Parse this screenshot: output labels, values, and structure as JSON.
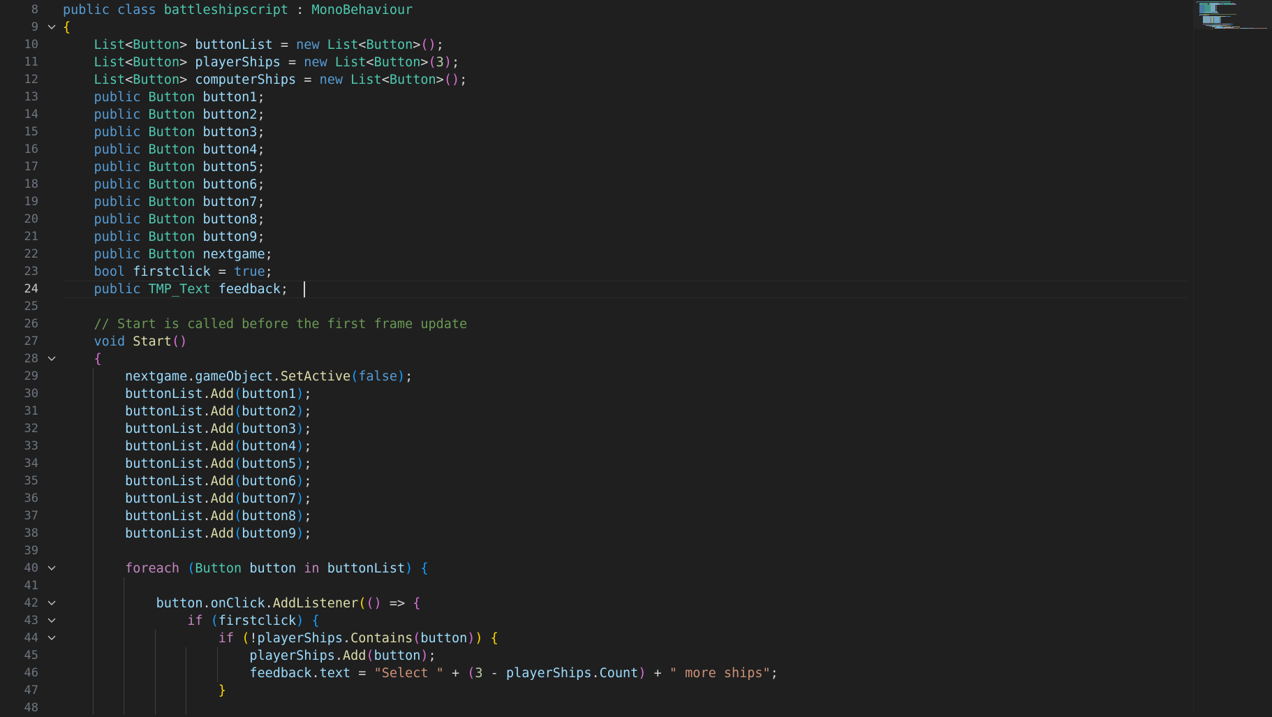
{
  "editor": {
    "language": "C#",
    "active_line": 24,
    "cursor_line": 24,
    "cursor_col": 31,
    "fold_lines": [
      9,
      28,
      40,
      42,
      43,
      44
    ],
    "line_numbers": [
      "8",
      "9",
      "10",
      "11",
      "12",
      "13",
      "14",
      "15",
      "16",
      "17",
      "18",
      "19",
      "20",
      "21",
      "22",
      "23",
      "24",
      "25",
      "26",
      "27",
      "28",
      "29",
      "30",
      "31",
      "32",
      "33",
      "34",
      "35",
      "36",
      "37",
      "38",
      "39",
      "40",
      "41",
      "42",
      "43",
      "44",
      "45",
      "46",
      "47",
      "48"
    ],
    "lines": [
      {
        "n": 8,
        "indent": 0,
        "tokens": [
          [
            "kw",
            "public "
          ],
          [
            "kw",
            "class "
          ],
          [
            "type",
            "battleshipscript "
          ],
          [
            "pun",
            ": "
          ],
          [
            "type",
            "MonoBehaviour"
          ]
        ]
      },
      {
        "n": 9,
        "indent": 0,
        "tokens": [
          [
            "b1",
            "{"
          ]
        ]
      },
      {
        "n": 10,
        "indent": 4,
        "tokens": [
          [
            "type",
            "List"
          ],
          [
            "pun",
            "<"
          ],
          [
            "type",
            "Button"
          ],
          [
            "pun",
            "> "
          ],
          [
            "var",
            "buttonList "
          ],
          [
            "pun",
            "= "
          ],
          [
            "kw",
            "new "
          ],
          [
            "type",
            "List"
          ],
          [
            "pun",
            "<"
          ],
          [
            "type",
            "Button"
          ],
          [
            "pun",
            ">"
          ],
          [
            "b2",
            "()"
          ],
          [
            "pun",
            ";"
          ]
        ]
      },
      {
        "n": 11,
        "indent": 4,
        "tokens": [
          [
            "type",
            "List"
          ],
          [
            "pun",
            "<"
          ],
          [
            "type",
            "Button"
          ],
          [
            "pun",
            "> "
          ],
          [
            "var",
            "playerShips "
          ],
          [
            "pun",
            "= "
          ],
          [
            "kw",
            "new "
          ],
          [
            "type",
            "List"
          ],
          [
            "pun",
            "<"
          ],
          [
            "type",
            "Button"
          ],
          [
            "pun",
            ">"
          ],
          [
            "b2",
            "("
          ],
          [
            "num",
            "3"
          ],
          [
            "b2",
            ")"
          ],
          [
            "pun",
            ";"
          ]
        ]
      },
      {
        "n": 12,
        "indent": 4,
        "tokens": [
          [
            "type",
            "List"
          ],
          [
            "pun",
            "<"
          ],
          [
            "type",
            "Button"
          ],
          [
            "pun",
            "> "
          ],
          [
            "var",
            "computerShips "
          ],
          [
            "pun",
            "= "
          ],
          [
            "kw",
            "new "
          ],
          [
            "type",
            "List"
          ],
          [
            "pun",
            "<"
          ],
          [
            "type",
            "Button"
          ],
          [
            "pun",
            ">"
          ],
          [
            "b2",
            "()"
          ],
          [
            "pun",
            ";"
          ]
        ]
      },
      {
        "n": 13,
        "indent": 4,
        "tokens": [
          [
            "kw",
            "public "
          ],
          [
            "type",
            "Button "
          ],
          [
            "var",
            "button1"
          ],
          [
            "pun",
            ";"
          ]
        ]
      },
      {
        "n": 14,
        "indent": 4,
        "tokens": [
          [
            "kw",
            "public "
          ],
          [
            "type",
            "Button "
          ],
          [
            "var",
            "button2"
          ],
          [
            "pun",
            ";"
          ]
        ]
      },
      {
        "n": 15,
        "indent": 4,
        "tokens": [
          [
            "kw",
            "public "
          ],
          [
            "type",
            "Button "
          ],
          [
            "var",
            "button3"
          ],
          [
            "pun",
            ";"
          ]
        ]
      },
      {
        "n": 16,
        "indent": 4,
        "tokens": [
          [
            "kw",
            "public "
          ],
          [
            "type",
            "Button "
          ],
          [
            "var",
            "button4"
          ],
          [
            "pun",
            ";"
          ]
        ]
      },
      {
        "n": 17,
        "indent": 4,
        "tokens": [
          [
            "kw",
            "public "
          ],
          [
            "type",
            "Button "
          ],
          [
            "var",
            "button5"
          ],
          [
            "pun",
            ";"
          ]
        ]
      },
      {
        "n": 18,
        "indent": 4,
        "tokens": [
          [
            "kw",
            "public "
          ],
          [
            "type",
            "Button "
          ],
          [
            "var",
            "button6"
          ],
          [
            "pun",
            ";"
          ]
        ]
      },
      {
        "n": 19,
        "indent": 4,
        "tokens": [
          [
            "kw",
            "public "
          ],
          [
            "type",
            "Button "
          ],
          [
            "var",
            "button7"
          ],
          [
            "pun",
            ";"
          ]
        ]
      },
      {
        "n": 20,
        "indent": 4,
        "tokens": [
          [
            "kw",
            "public "
          ],
          [
            "type",
            "Button "
          ],
          [
            "var",
            "button8"
          ],
          [
            "pun",
            ";"
          ]
        ]
      },
      {
        "n": 21,
        "indent": 4,
        "tokens": [
          [
            "kw",
            "public "
          ],
          [
            "type",
            "Button "
          ],
          [
            "var",
            "button9"
          ],
          [
            "pun",
            ";"
          ]
        ]
      },
      {
        "n": 22,
        "indent": 4,
        "tokens": [
          [
            "kw",
            "public "
          ],
          [
            "type",
            "Button "
          ],
          [
            "var",
            "nextgame"
          ],
          [
            "pun",
            ";"
          ]
        ]
      },
      {
        "n": 23,
        "indent": 4,
        "tokens": [
          [
            "kw",
            "bool "
          ],
          [
            "var",
            "firstclick "
          ],
          [
            "pun",
            "= "
          ],
          [
            "kw",
            "true"
          ],
          [
            "pun",
            ";"
          ]
        ]
      },
      {
        "n": 24,
        "indent": 4,
        "tokens": [
          [
            "kw",
            "public "
          ],
          [
            "type",
            "TMP_Text "
          ],
          [
            "var",
            "feedback"
          ],
          [
            "pun",
            ";"
          ]
        ]
      },
      {
        "n": 25,
        "indent": 0,
        "tokens": []
      },
      {
        "n": 26,
        "indent": 4,
        "tokens": [
          [
            "com",
            "// Start is called before the first frame update"
          ]
        ]
      },
      {
        "n": 27,
        "indent": 4,
        "tokens": [
          [
            "kw",
            "void "
          ],
          [
            "fn",
            "Start"
          ],
          [
            "b2",
            "()"
          ]
        ]
      },
      {
        "n": 28,
        "indent": 4,
        "tokens": [
          [
            "b2",
            "{"
          ]
        ]
      },
      {
        "n": 29,
        "indent": 8,
        "tokens": [
          [
            "var",
            "nextgame"
          ],
          [
            "pun",
            "."
          ],
          [
            "var",
            "gameObject"
          ],
          [
            "pun",
            "."
          ],
          [
            "fn",
            "SetActive"
          ],
          [
            "b3",
            "("
          ],
          [
            "kw",
            "false"
          ],
          [
            "b3",
            ")"
          ],
          [
            "pun",
            ";"
          ]
        ]
      },
      {
        "n": 30,
        "indent": 8,
        "tokens": [
          [
            "var",
            "buttonList"
          ],
          [
            "pun",
            "."
          ],
          [
            "fn",
            "Add"
          ],
          [
            "b3",
            "("
          ],
          [
            "var",
            "button1"
          ],
          [
            "b3",
            ")"
          ],
          [
            "pun",
            ";"
          ]
        ]
      },
      {
        "n": 31,
        "indent": 8,
        "tokens": [
          [
            "var",
            "buttonList"
          ],
          [
            "pun",
            "."
          ],
          [
            "fn",
            "Add"
          ],
          [
            "b3",
            "("
          ],
          [
            "var",
            "button2"
          ],
          [
            "b3",
            ")"
          ],
          [
            "pun",
            ";"
          ]
        ]
      },
      {
        "n": 32,
        "indent": 8,
        "tokens": [
          [
            "var",
            "buttonList"
          ],
          [
            "pun",
            "."
          ],
          [
            "fn",
            "Add"
          ],
          [
            "b3",
            "("
          ],
          [
            "var",
            "button3"
          ],
          [
            "b3",
            ")"
          ],
          [
            "pun",
            ";"
          ]
        ]
      },
      {
        "n": 33,
        "indent": 8,
        "tokens": [
          [
            "var",
            "buttonList"
          ],
          [
            "pun",
            "."
          ],
          [
            "fn",
            "Add"
          ],
          [
            "b3",
            "("
          ],
          [
            "var",
            "button4"
          ],
          [
            "b3",
            ")"
          ],
          [
            "pun",
            ";"
          ]
        ]
      },
      {
        "n": 34,
        "indent": 8,
        "tokens": [
          [
            "var",
            "buttonList"
          ],
          [
            "pun",
            "."
          ],
          [
            "fn",
            "Add"
          ],
          [
            "b3",
            "("
          ],
          [
            "var",
            "button5"
          ],
          [
            "b3",
            ")"
          ],
          [
            "pun",
            ";"
          ]
        ]
      },
      {
        "n": 35,
        "indent": 8,
        "tokens": [
          [
            "var",
            "buttonList"
          ],
          [
            "pun",
            "."
          ],
          [
            "fn",
            "Add"
          ],
          [
            "b3",
            "("
          ],
          [
            "var",
            "button6"
          ],
          [
            "b3",
            ")"
          ],
          [
            "pun",
            ";"
          ]
        ]
      },
      {
        "n": 36,
        "indent": 8,
        "tokens": [
          [
            "var",
            "buttonList"
          ],
          [
            "pun",
            "."
          ],
          [
            "fn",
            "Add"
          ],
          [
            "b3",
            "("
          ],
          [
            "var",
            "button7"
          ],
          [
            "b3",
            ")"
          ],
          [
            "pun",
            ";"
          ]
        ]
      },
      {
        "n": 37,
        "indent": 8,
        "tokens": [
          [
            "var",
            "buttonList"
          ],
          [
            "pun",
            "."
          ],
          [
            "fn",
            "Add"
          ],
          [
            "b3",
            "("
          ],
          [
            "var",
            "button8"
          ],
          [
            "b3",
            ")"
          ],
          [
            "pun",
            ";"
          ]
        ]
      },
      {
        "n": 38,
        "indent": 8,
        "tokens": [
          [
            "var",
            "buttonList"
          ],
          [
            "pun",
            "."
          ],
          [
            "fn",
            "Add"
          ],
          [
            "b3",
            "("
          ],
          [
            "var",
            "button9"
          ],
          [
            "b3",
            ")"
          ],
          [
            "pun",
            ";"
          ]
        ]
      },
      {
        "n": 39,
        "indent": 0,
        "tokens": []
      },
      {
        "n": 40,
        "indent": 8,
        "tokens": [
          [
            "ctrl",
            "foreach "
          ],
          [
            "b3",
            "("
          ],
          [
            "type",
            "Button "
          ],
          [
            "var",
            "button "
          ],
          [
            "ctrl",
            "in "
          ],
          [
            "var",
            "buttonList"
          ],
          [
            "b3",
            ") {"
          ]
        ]
      },
      {
        "n": 41,
        "indent": 0,
        "tokens": []
      },
      {
        "n": 42,
        "indent": 12,
        "tokens": [
          [
            "var",
            "button"
          ],
          [
            "pun",
            "."
          ],
          [
            "var",
            "onClick"
          ],
          [
            "pun",
            "."
          ],
          [
            "fn",
            "AddListener"
          ],
          [
            "b1",
            "("
          ],
          [
            "b2",
            "()"
          ],
          [
            "pun",
            " => "
          ],
          [
            "b2",
            "{"
          ]
        ]
      },
      {
        "n": 43,
        "indent": 16,
        "tokens": [
          [
            "ctrl",
            "if "
          ],
          [
            "b3",
            "("
          ],
          [
            "var",
            "firstclick"
          ],
          [
            "b3",
            ") {"
          ]
        ]
      },
      {
        "n": 44,
        "indent": 20,
        "tokens": [
          [
            "ctrl",
            "if "
          ],
          [
            "b1",
            "("
          ],
          [
            "pun",
            "!"
          ],
          [
            "var",
            "playerShips"
          ],
          [
            "pun",
            "."
          ],
          [
            "fn",
            "Contains"
          ],
          [
            "b2",
            "("
          ],
          [
            "var",
            "button"
          ],
          [
            "b2",
            ")"
          ],
          [
            "b1",
            ") {"
          ]
        ]
      },
      {
        "n": 45,
        "indent": 24,
        "tokens": [
          [
            "var",
            "playerShips"
          ],
          [
            "pun",
            "."
          ],
          [
            "fn",
            "Add"
          ],
          [
            "b2",
            "("
          ],
          [
            "var",
            "button"
          ],
          [
            "b2",
            ")"
          ],
          [
            "pun",
            ";"
          ]
        ]
      },
      {
        "n": 46,
        "indent": 24,
        "tokens": [
          [
            "var",
            "feedback"
          ],
          [
            "pun",
            "."
          ],
          [
            "var",
            "text "
          ],
          [
            "pun",
            "= "
          ],
          [
            "str",
            "\"Select \" "
          ],
          [
            "pun",
            "+ "
          ],
          [
            "b2",
            "("
          ],
          [
            "num",
            "3 "
          ],
          [
            "pun",
            "- "
          ],
          [
            "var",
            "playerShips"
          ],
          [
            "pun",
            "."
          ],
          [
            "var",
            "Count"
          ],
          [
            "b2",
            ") "
          ],
          [
            "pun",
            "+ "
          ],
          [
            "str",
            "\" more ships\""
          ],
          [
            "pun",
            ";"
          ]
        ]
      },
      {
        "n": 47,
        "indent": 20,
        "tokens": [
          [
            "b1",
            "}"
          ]
        ]
      },
      {
        "n": 48,
        "indent": 0,
        "tokens": []
      }
    ],
    "guides": [
      {
        "col": 0,
        "from": 10,
        "to": 48,
        "active": true
      },
      {
        "col": 4,
        "from": 29,
        "to": 48,
        "active": false
      },
      {
        "col": 8,
        "from": 41,
        "to": 48,
        "active": false
      },
      {
        "col": 12,
        "from": 44,
        "to": 48,
        "active": false
      },
      {
        "col": 16,
        "from": 45,
        "to": 48,
        "active": false
      },
      {
        "col": 20,
        "from": 45,
        "to": 46,
        "active": false
      }
    ]
  },
  "colors": {
    "background": "#1f1f1f",
    "keyword": "#569cd6",
    "control": "#c586c0",
    "type": "#4ec9b0",
    "variable": "#9cdcfe",
    "function": "#dcdcaa",
    "number": "#b5cea8",
    "string": "#ce9178",
    "comment": "#6a9955",
    "bracket1": "#ffd700",
    "bracket2": "#da70d6",
    "bracket3": "#179fff"
  },
  "minimap": {
    "visible": true
  }
}
